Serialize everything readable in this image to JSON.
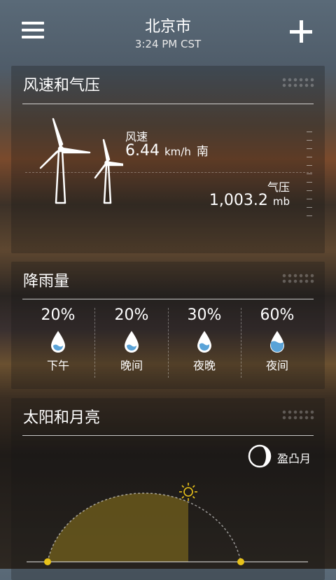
{
  "header": {
    "city": "北京市",
    "time": "3:24 PM CST"
  },
  "wind_pressure": {
    "title": "风速和气压",
    "wind_label": "风速",
    "wind_value": "6.44",
    "wind_unit": "km/h",
    "wind_direction": "南",
    "pressure_label": "气压",
    "pressure_value": "1,003.2",
    "pressure_unit": "mb"
  },
  "precipitation": {
    "title": "降雨量",
    "periods": [
      {
        "percent": "20%",
        "label": "下午"
      },
      {
        "percent": "20%",
        "label": "晚间"
      },
      {
        "percent": "30%",
        "label": "夜晚"
      },
      {
        "percent": "60%",
        "label": "夜间"
      }
    ]
  },
  "sun_moon": {
    "title": "太阳和月亮",
    "moon_phase": "盈凸月"
  },
  "colors": {
    "sun_fill": "#6f5e1c",
    "sun_marker": "#e8c21a"
  }
}
